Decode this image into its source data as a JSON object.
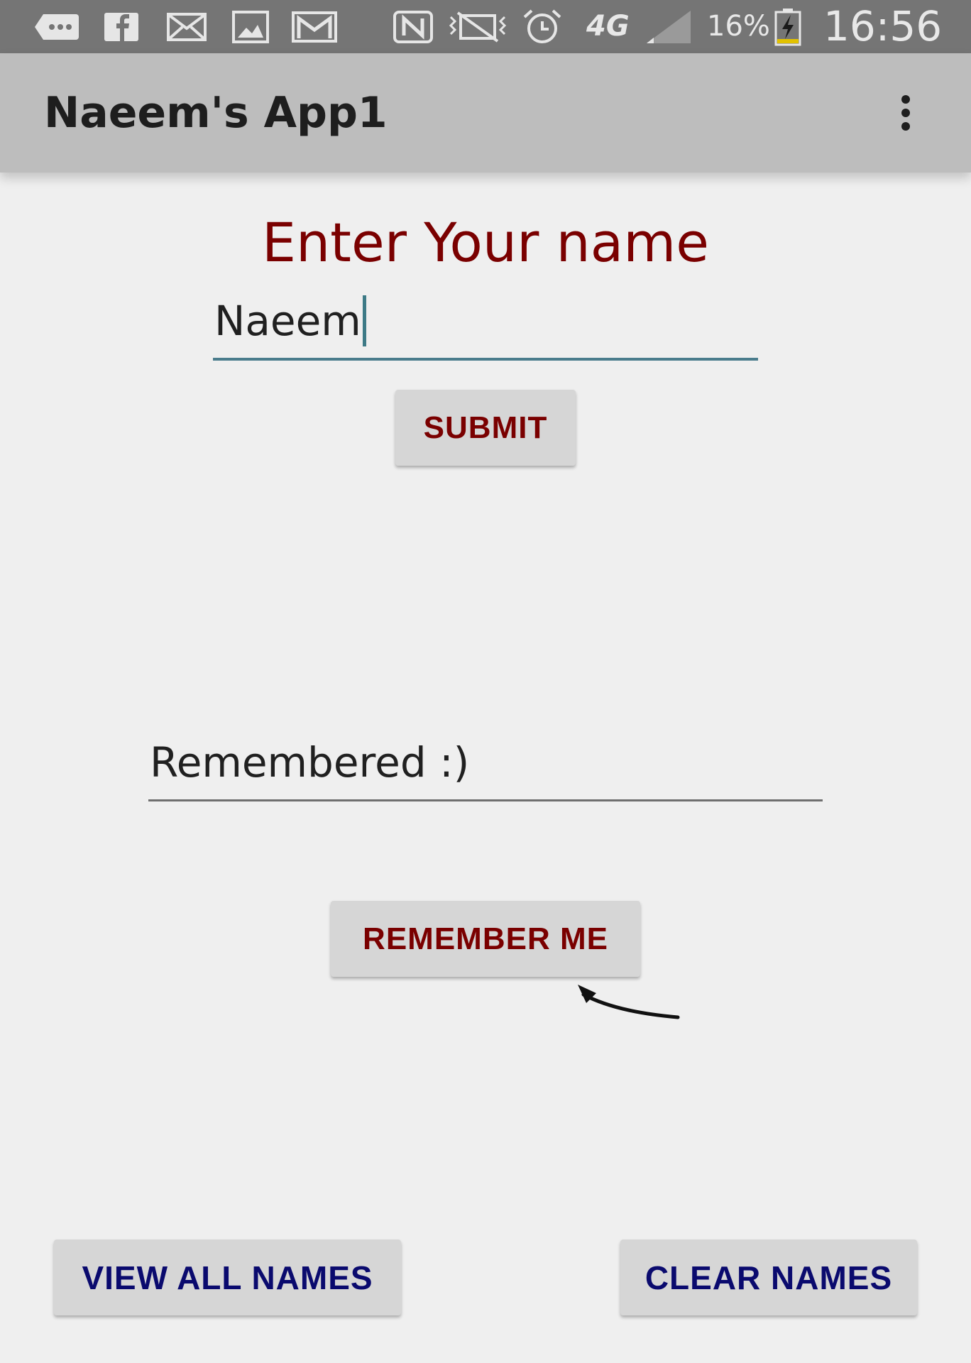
{
  "status_bar": {
    "battery": "16%",
    "time": "16:56",
    "network": "4G",
    "icons": [
      "chat-icon",
      "facebook-icon",
      "email-icon",
      "gallery-icon",
      "gmail-icon",
      "nfc-icon",
      "vibrate-icon",
      "alarm-icon",
      "network-4g-icon",
      "signal-icon",
      "battery-charging-icon"
    ]
  },
  "app_bar": {
    "title": "Naeem's App1",
    "menu_icon": "more-vert-icon"
  },
  "form": {
    "heading": "Enter Your name",
    "name_value": "Naeem",
    "submit_label": "SUBMIT",
    "remembered_value": "Remembered :)",
    "remember_label": "REMEMBER ME"
  },
  "footer": {
    "view_all_label": "VIEW ALL NAMES",
    "clear_label": "CLEAR NAMES"
  },
  "colors": {
    "accent_maroon": "#7a0000",
    "accent_navy": "#0a0a6e",
    "app_bar": "#bdbdbd",
    "status_bar": "#757575"
  }
}
